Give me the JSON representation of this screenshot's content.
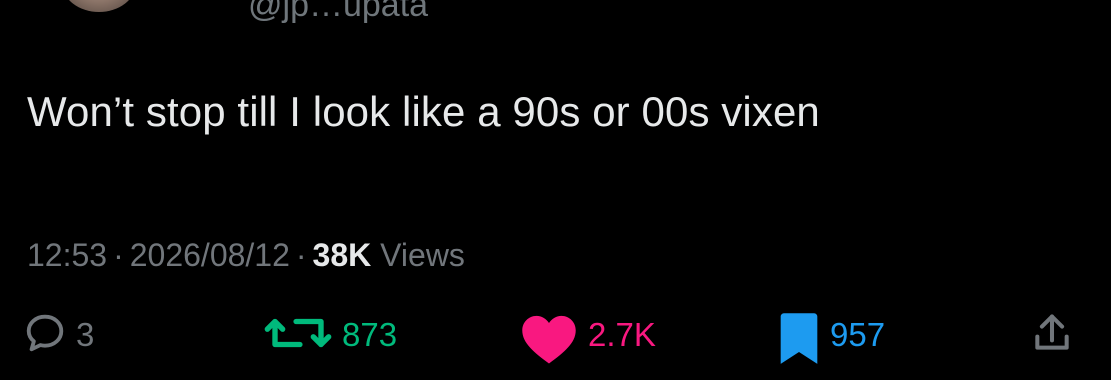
{
  "author": {
    "handle_partial": "@jp…upata"
  },
  "tweet": {
    "text": "Won’t stop till I look like a 90s or 00s vixen",
    "time": "12:53",
    "date": "2026/08/12",
    "views_count": "38K",
    "views_label": "Views",
    "separator": "·"
  },
  "actions": {
    "replies": "3",
    "retweets": "873",
    "likes": "2.7K",
    "bookmarks": "957"
  },
  "colors": {
    "background": "#000000",
    "text": "#e7e9ea",
    "muted": "#71767b",
    "retweet": "#00ba7c",
    "like": "#f91880",
    "bookmark": "#1d9bf0"
  },
  "icons": {
    "reply": "speech-bubble-icon",
    "retweet": "retweet-arrows-icon",
    "like": "heart-icon",
    "bookmark": "bookmark-icon",
    "share": "share-icon"
  }
}
